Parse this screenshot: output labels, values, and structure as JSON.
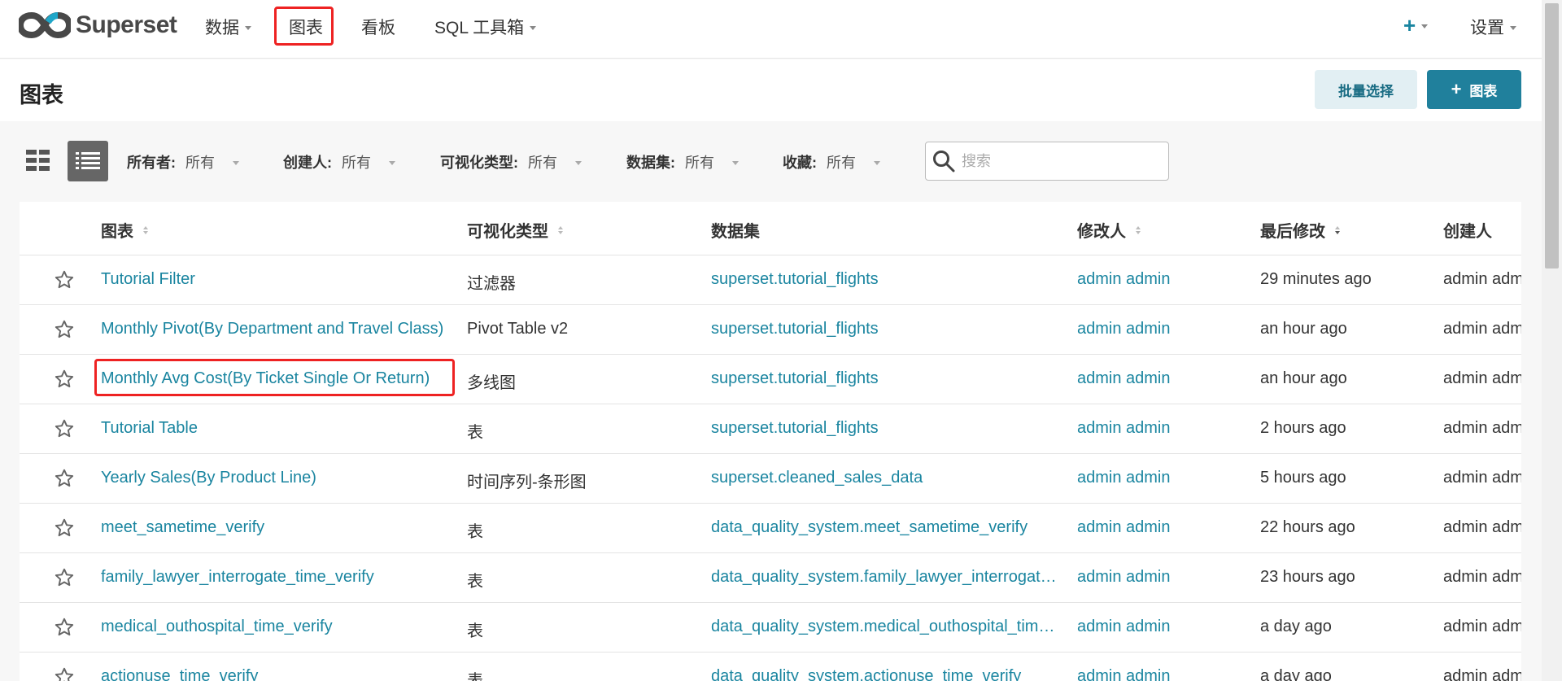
{
  "nav": {
    "brand": "Superset",
    "items": [
      {
        "label": "数据",
        "dropdown": true
      },
      {
        "label": "图表",
        "dropdown": false,
        "active": true
      },
      {
        "label": "看板",
        "dropdown": false
      },
      {
        "label": "SQL 工具箱",
        "dropdown": true
      }
    ],
    "plus": "+",
    "settings": "设置"
  },
  "header": {
    "title": "图表",
    "bulk_select": "批量选择",
    "add_chart": "图表",
    "add_plus": "+"
  },
  "filters": [
    {
      "label": "所有者:",
      "value": "所有"
    },
    {
      "label": "创建人:",
      "value": "所有"
    },
    {
      "label": "可视化类型:",
      "value": "所有"
    },
    {
      "label": "数据集:",
      "value": "所有"
    },
    {
      "label": "收藏:",
      "value": "所有"
    }
  ],
  "search": {
    "placeholder": "搜索"
  },
  "table": {
    "columns": [
      "图表",
      "可视化类型",
      "数据集",
      "修改人",
      "最后修改",
      "创建人"
    ],
    "rows": [
      {
        "chart": "Tutorial Filter",
        "viz": "过滤器",
        "dataset": "superset.tutorial_flights",
        "modified_by": "admin admin",
        "modified": "29 minutes ago",
        "created_by": "admin admin"
      },
      {
        "chart": "Monthly Pivot(By Department and Travel Class)",
        "viz": "Pivot Table v2",
        "dataset": "superset.tutorial_flights",
        "modified_by": "admin admin",
        "modified": "an hour ago",
        "created_by": "admin admin"
      },
      {
        "chart": "Monthly Avg Cost(By Ticket Single Or Return)",
        "viz": "多线图",
        "dataset": "superset.tutorial_flights",
        "modified_by": "admin admin",
        "modified": "an hour ago",
        "created_by": "admin admin"
      },
      {
        "chart": "Tutorial Table",
        "viz": "表",
        "dataset": "superset.tutorial_flights",
        "modified_by": "admin admin",
        "modified": "2 hours ago",
        "created_by": "admin admin"
      },
      {
        "chart": "Yearly Sales(By Product Line)",
        "viz": "时间序列-条形图",
        "dataset": "superset.cleaned_sales_data",
        "modified_by": "admin admin",
        "modified": "5 hours ago",
        "created_by": "admin admin"
      },
      {
        "chart": "meet_sametime_verify",
        "viz": "表",
        "dataset": "data_quality_system.meet_sametime_verify",
        "modified_by": "admin admin",
        "modified": "22 hours ago",
        "created_by": "admin admin"
      },
      {
        "chart": "family_lawyer_interrogate_time_verify",
        "viz": "表",
        "dataset": "data_quality_system.family_lawyer_interrogate_time_verify",
        "modified_by": "admin admin",
        "modified": "23 hours ago",
        "created_by": "admin admin"
      },
      {
        "chart": "medical_outhospital_time_verify",
        "viz": "表",
        "dataset": "data_quality_system.medical_outhospital_time_verify",
        "modified_by": "admin admin",
        "modified": "a day ago",
        "created_by": "admin admin"
      },
      {
        "chart": "actionuse_time_verify",
        "viz": "表",
        "dataset": "data_quality_system.actionuse_time_verify",
        "modified_by": "admin admin",
        "modified": "a day ago",
        "created_by": "admin admin"
      }
    ]
  },
  "colors": {
    "accent": "#1a85a0",
    "primary_button": "#20809c",
    "highlight": "#ee2222"
  }
}
